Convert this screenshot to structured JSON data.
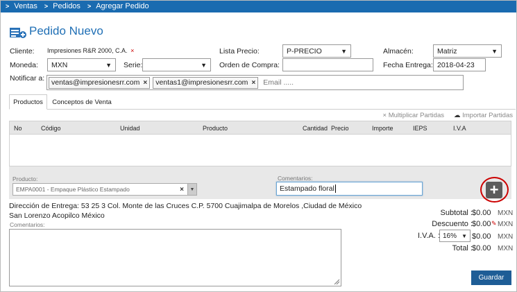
{
  "breadcrumb": [
    "Ventas",
    "Pedidos",
    "Agregar Pedido"
  ],
  "page_title": "Pedido Nuevo",
  "form": {
    "cliente_label": "Cliente:",
    "cliente_value": "Impresiones R&R 2000, C.A.",
    "cliente_clear": "×",
    "lista_precio_label": "Lista Precio:",
    "lista_precio_value": "P-PRECIO",
    "almacen_label": "Almacén:",
    "almacen_value": "Matriz",
    "moneda_label": "Moneda:",
    "moneda_value": "MXN",
    "serie_label": "Serie:",
    "serie_value": "",
    "orden_compra_label": "Orden de Compra:",
    "orden_compra_value": "",
    "fecha_entrega_label": "Fecha Entrega:",
    "fecha_entrega_value": "2018-04-23",
    "notificar_label": "Notificar a:",
    "notificar_tags": [
      "ventas@impresionesrr.com",
      "ventas1@impresionesrr.com"
    ],
    "email_placeholder": "Email ....."
  },
  "tabs": [
    "Productos",
    "Conceptos de Venta"
  ],
  "tools": {
    "multiplicar": "Multiplicar Partidas",
    "importar": "Importar Partidas"
  },
  "grid_columns": [
    "No",
    "Código",
    "Unidad",
    "Producto",
    "Cantidad",
    "Precio",
    "Importe",
    "IEPS",
    "I.V.A"
  ],
  "entry": {
    "producto_label": "Producto:",
    "producto_value": "EMPA0001 - Empaque Plástico Estampado",
    "comentarios_label": "Comentarios:",
    "comentarios_value": "Estampado floral"
  },
  "address": "Dirección de Entrega: 53 25 3 Col. Monte de las Cruces C.P. 5700 Cuajimalpa de Morelos ,Ciudad de México San Lorenzo Acopilco México",
  "comments_label": "Comentarios:",
  "totals": {
    "subtotal_label": "Subtotal :",
    "subtotal_value": "$0.00",
    "descuento_label": "Descuento :",
    "descuento_value": "$0.00",
    "iva_label": "I.V.A. :",
    "iva_rate": "16%",
    "iva_value": "$0.00",
    "total_label": "Total :",
    "total_value": "$0.00",
    "currency": "MXN"
  },
  "save_label": "Guardar",
  "colors": {
    "brand": "#1a6bb0",
    "title": "#1f6fb5",
    "save": "#1e5d96",
    "highlight": "#cc0000"
  }
}
